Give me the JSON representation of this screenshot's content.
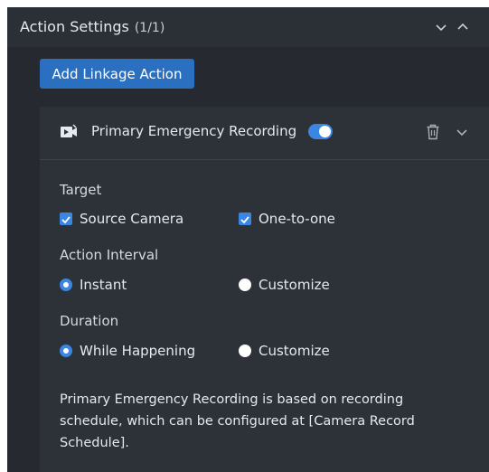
{
  "section": {
    "title": "Action Settings",
    "count": "(1/1)"
  },
  "add_button_label": "Add Linkage Action",
  "action": {
    "title": "Primary Emergency Recording",
    "enabled": true,
    "target": {
      "label": "Target",
      "options": [
        {
          "label": "Source Camera",
          "checked": true
        },
        {
          "label": "One-to-one",
          "checked": true
        }
      ]
    },
    "interval": {
      "label": "Action Interval",
      "options": [
        {
          "label": "Instant",
          "selected": true
        },
        {
          "label": "Customize",
          "selected": false
        }
      ]
    },
    "duration": {
      "label": "Duration",
      "options": [
        {
          "label": "While Happening",
          "selected": true
        },
        {
          "label": "Customize",
          "selected": false
        }
      ]
    },
    "note": "Primary Emergency Recording is based on recording schedule, which can be configured at [Camera Record Schedule]."
  },
  "colors": {
    "accent": "#3a86e0",
    "button": "#2a6fc0",
    "panel": "#262a30",
    "card": "#2d3138"
  },
  "icons": [
    "chevron-down-icon",
    "chevron-up-icon",
    "recording-camera-icon",
    "trash-icon",
    "chevron-down-icon"
  ]
}
